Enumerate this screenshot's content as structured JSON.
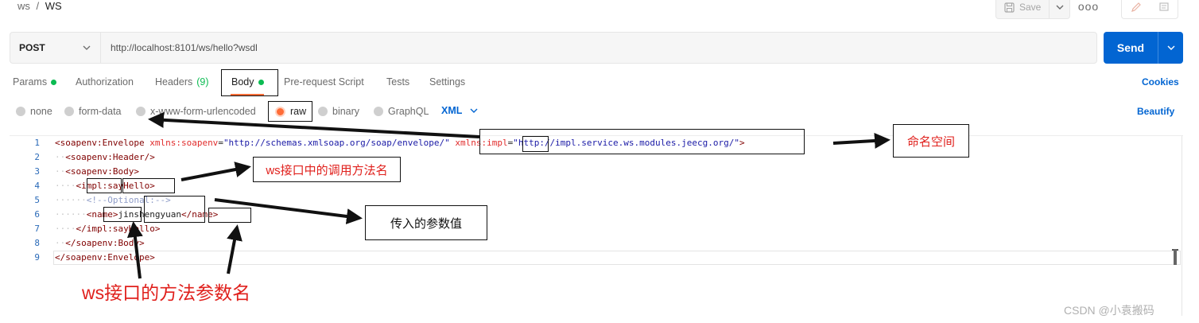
{
  "breadcrumb": {
    "parent": "ws",
    "separator": "/",
    "current": "WS"
  },
  "toolbar": {
    "save_label": "Save",
    "more_label": "ooo"
  },
  "request": {
    "method": "POST",
    "url": "http://localhost:8101/ws/hello?wsdl",
    "send_label": "Send"
  },
  "tabs": [
    {
      "label": "Params",
      "dot": true
    },
    {
      "label": "Authorization"
    },
    {
      "label": "Headers",
      "count": "(9)"
    },
    {
      "label": "Body",
      "dot": true,
      "active": true
    },
    {
      "label": "Pre-request Script"
    },
    {
      "label": "Tests"
    },
    {
      "label": "Settings"
    }
  ],
  "cookies_label": "Cookies",
  "body_types": [
    {
      "label": "none"
    },
    {
      "label": "form-data"
    },
    {
      "label": "x-www-form-urlencoded"
    },
    {
      "label": "raw",
      "selected": true
    },
    {
      "label": "binary"
    },
    {
      "label": "GraphQL"
    }
  ],
  "language": "XML",
  "beautify_label": "Beautify",
  "line_numbers": [
    "1",
    "2",
    "3",
    "4",
    "5",
    "6",
    "7",
    "8",
    "9"
  ],
  "code": {
    "l1": {
      "open": "<soapenv:Envelope",
      "attr1": " xmlns:soapenv",
      "eq1": "=",
      "val1": "\"http://schemas.xmlsoap.org/soap/envelope/\"",
      "attr2": " xmlns:impl",
      "eq2": "=",
      "val2": "\"http://impl.service.ws.modules.jeecg.org/\"",
      "close": ">"
    },
    "l2": {
      "indent": "··",
      "text": "<soapenv:Header/>"
    },
    "l3": {
      "indent": "··",
      "text": "<soapenv:Body>"
    },
    "l4": {
      "indent": "····",
      "text": "<impl:sayHello>"
    },
    "l5": {
      "indent": "······",
      "text": "<!--Optional:-->"
    },
    "l6": {
      "indent": "······",
      "open": "<name>",
      "value": "jinshengyuan",
      "close": "</name>"
    },
    "l7": {
      "indent": "····",
      "text": "</impl:sayHello>"
    },
    "l8": {
      "indent": "··",
      "text": "</soapenv:Body>"
    },
    "l9": {
      "text": "</soapenv:Envelope>"
    }
  },
  "annotations": {
    "namespace": "命名空间",
    "method_name": "ws接口中的调用方法名",
    "param_value": "传入的参数值",
    "param_name": "ws接口的方法参数名"
  },
  "watermark": "CSDN @小袁搬码",
  "colors": {
    "send": "#0265d2",
    "accent": "#ff6c37",
    "green": "#0cbb52",
    "annotation_red": "#e0201c"
  }
}
